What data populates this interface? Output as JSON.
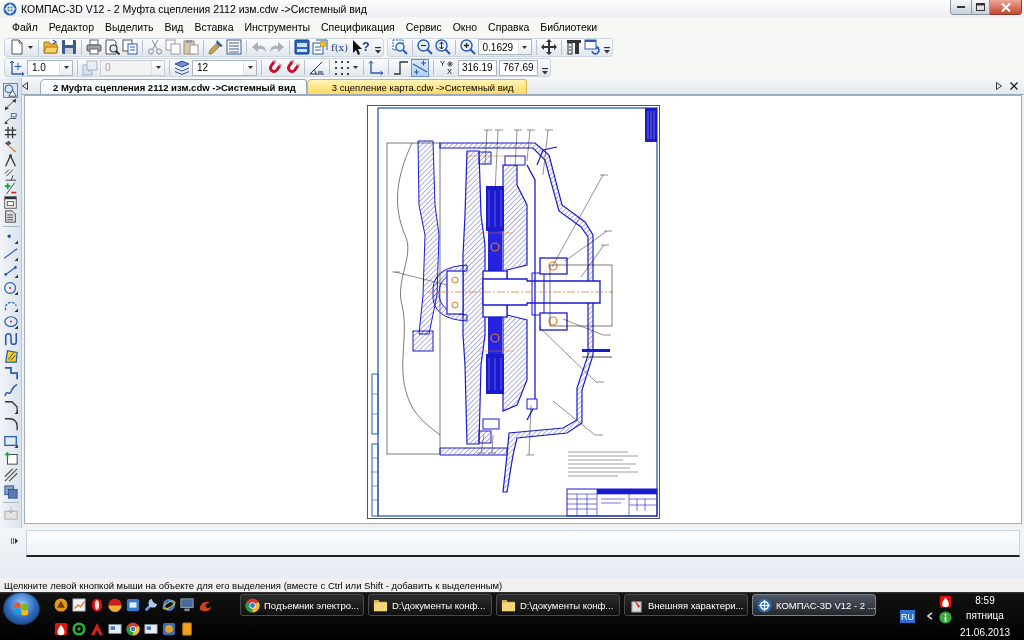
{
  "window": {
    "title": "КОМПАС-3D V12 - 2 Муфта сцепления 2112 изм.cdw ->Системный вид"
  },
  "menu": [
    "Файл",
    "Редактор",
    "Выделить",
    "Вид",
    "Вставка",
    "Инструменты",
    "Спецификация",
    "Сервис",
    "Окно",
    "Справка",
    "Библиотеки"
  ],
  "toolbar_standard": {
    "formula": "f(x)",
    "help": "?",
    "zoom": "0.1629"
  },
  "toolbar_current_state": {
    "line_style": "1.0",
    "state": {
      "value": "0",
      "disabled": true
    },
    "layer": "12",
    "ortho": {
      "on": true
    },
    "axis_y": "Y",
    "axis_x": "X",
    "coordinate_1": "316.19",
    "coordinate_2": "767.69"
  },
  "document_tabs": [
    {
      "label": "2 Муфта сцепления 2112 изм.cdw ->Системный вид",
      "selected": true
    },
    {
      "label": "3 сцепление карта.cdw ->Системный вид",
      "selected": false
    }
  ],
  "tool_panels": [
    {
      "selected": true
    },
    {
      "selected": false
    },
    {
      "selected": false
    },
    {
      "selected": false
    },
    {
      "selected": false
    },
    {
      "selected": false
    },
    {
      "selected": false
    },
    {
      "selected": false
    },
    {
      "selected": false
    },
    {
      "selected": false
    }
  ],
  "status_bar": {
    "hint": "Щелкните левой кнопкой мыши на объекте для его выделения (вместе с Ctrl или Shift - добавить к выделенным)"
  },
  "taskbar": {
    "tasks": [
      {
        "kind": "browser",
        "label": "Подъемник электро...",
        "selected": false
      },
      {
        "kind": "folder",
        "label": "D:\\документы конф...",
        "selected": false
      },
      {
        "kind": "folder",
        "label": "D:\\документы конф...",
        "selected": false
      },
      {
        "kind": "document",
        "label": "Внешняя характери...",
        "selected": false
      },
      {
        "kind": "app",
        "label": "КОМПАС-3D V12 - 2 ...",
        "selected": true
      }
    ],
    "language": "RU",
    "time": "8:59",
    "weekday": "пятница",
    "date": "21.06.2013"
  }
}
